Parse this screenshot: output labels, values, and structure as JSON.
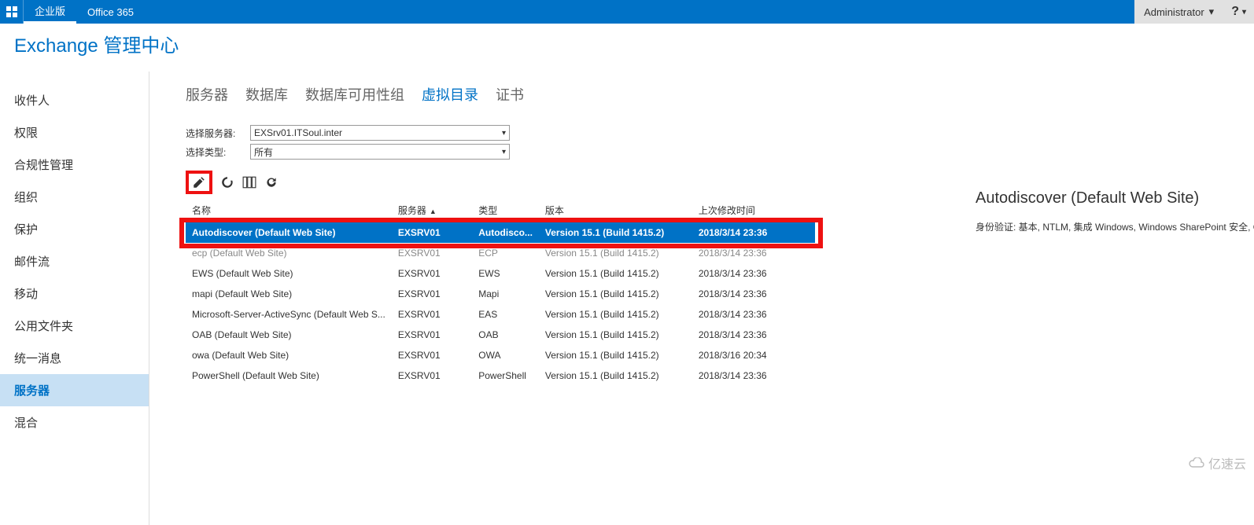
{
  "topbar": {
    "brand": "企业版",
    "product": "Office 365",
    "admin": "Administrator",
    "help": "?"
  },
  "page_title": "Exchange 管理中心",
  "sidebar": {
    "items": [
      {
        "label": "收件人"
      },
      {
        "label": "权限"
      },
      {
        "label": "合规性管理"
      },
      {
        "label": "组织"
      },
      {
        "label": "保护"
      },
      {
        "label": "邮件流"
      },
      {
        "label": "移动"
      },
      {
        "label": "公用文件夹"
      },
      {
        "label": "统一消息"
      },
      {
        "label": "服务器",
        "active": true
      },
      {
        "label": "混合"
      }
    ]
  },
  "tabs": [
    {
      "label": "服务器"
    },
    {
      "label": "数据库"
    },
    {
      "label": "数据库可用性组"
    },
    {
      "label": "虚拟目录",
      "active": true
    },
    {
      "label": "证书"
    }
  ],
  "filters": {
    "server_label": "选择服务器:",
    "server_value": "EXSrv01.ITSoul.inter",
    "type_label": "选择类型:",
    "type_value": "所有"
  },
  "columns": {
    "name": "名称",
    "server": "服务器",
    "type": "类型",
    "version": "版本",
    "modified": "上次修改时间"
  },
  "rows": [
    {
      "name": "Autodiscover (Default Web Site)",
      "server": "EXSRV01",
      "type": "Autodisco...",
      "version": "Version 15.1 (Build 1415.2)",
      "modified": "2018/3/14 23:36",
      "selected": true
    },
    {
      "name": "ecp (Default Web Site)",
      "server": "EXSRV01",
      "type": "ECP",
      "version": "Version 15.1 (Build 1415.2)",
      "modified": "2018/3/14 23:36",
      "dim": true
    },
    {
      "name": "EWS (Default Web Site)",
      "server": "EXSRV01",
      "type": "EWS",
      "version": "Version 15.1 (Build 1415.2)",
      "modified": "2018/3/14 23:36"
    },
    {
      "name": "mapi (Default Web Site)",
      "server": "EXSRV01",
      "type": "Mapi",
      "version": "Version 15.1 (Build 1415.2)",
      "modified": "2018/3/14 23:36"
    },
    {
      "name": "Microsoft-Server-ActiveSync (Default Web S...",
      "server": "EXSRV01",
      "type": "EAS",
      "version": "Version 15.1 (Build 1415.2)",
      "modified": "2018/3/14 23:36"
    },
    {
      "name": "OAB (Default Web Site)",
      "server": "EXSRV01",
      "type": "OAB",
      "version": "Version 15.1 (Build 1415.2)",
      "modified": "2018/3/14 23:36"
    },
    {
      "name": "owa (Default Web Site)",
      "server": "EXSRV01",
      "type": "OWA",
      "version": "Version 15.1 (Build 1415.2)",
      "modified": "2018/3/16 20:34"
    },
    {
      "name": "PowerShell (Default Web Site)",
      "server": "EXSRV01",
      "type": "PowerShell",
      "version": "Version 15.1 (Build 1415.2)",
      "modified": "2018/3/14 23:36"
    }
  ],
  "details": {
    "title": "Autodiscover (Default Web Site)",
    "auth": "身份验证: 基本, NTLM, 集成 Windows, Windows SharePoint 安全, OAuth"
  },
  "watermark": "亿速云"
}
